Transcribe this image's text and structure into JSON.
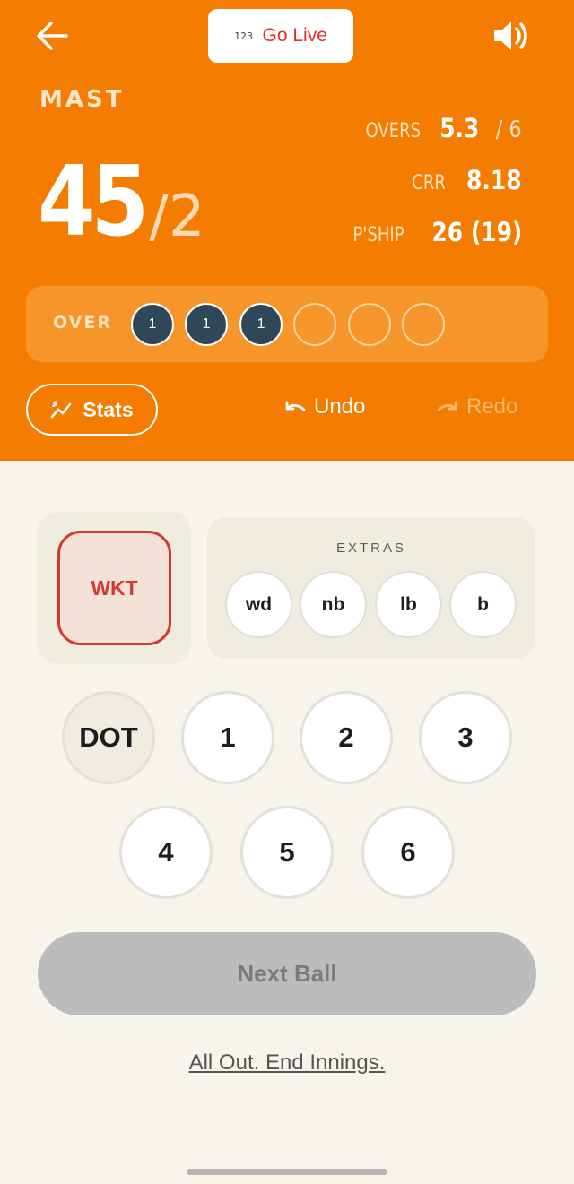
{
  "header": {
    "go_live_icon_text": "123",
    "go_live_label": "Go Live",
    "team_name": "MAST",
    "score": {
      "runs": "45",
      "separator": "/",
      "wickets": "2"
    },
    "overs_label": "OVERS",
    "overs_value": "5.3",
    "overs_total": "/ 6",
    "crr_label": "CRR",
    "crr_value": "8.18",
    "pship_label": "P'SHIP",
    "pship_value": "26 (19)",
    "over_label": "OVER",
    "over_balls": [
      "1",
      "1",
      "1",
      "",
      "",
      ""
    ],
    "stats_label": "Stats",
    "undo_label": "Undo",
    "redo_label": "Redo"
  },
  "controls": {
    "wkt_label": "WKT",
    "extras_title": "EXTRAS",
    "extras": [
      "wd",
      "nb",
      "lb",
      "b"
    ],
    "runs": [
      "DOT",
      "1",
      "2",
      "3",
      "4",
      "5",
      "6"
    ],
    "next_ball_label": "Next Ball",
    "end_innings_label": "All Out. End Innings."
  },
  "colors": {
    "header_bg": "#f47c00",
    "page_bg": "#f7f4ea",
    "wicket_red": "#d23a33",
    "ball_dark": "#2f4756"
  },
  "icons": [
    "back-arrow-icon",
    "number-icon",
    "speaker-icon",
    "trend-chart-icon",
    "undo-arrow-icon",
    "redo-arrow-icon"
  ]
}
